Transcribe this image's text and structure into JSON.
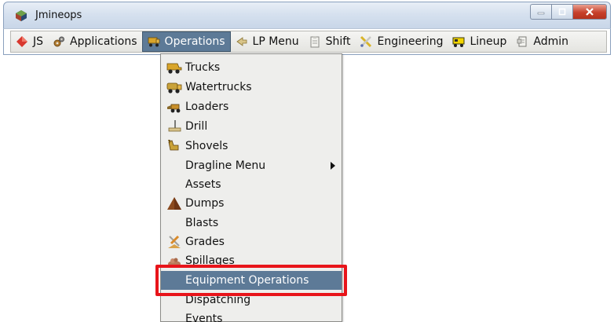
{
  "window": {
    "title": "Jmineops",
    "controls": {
      "minimize": "–",
      "maximize": "□",
      "close": "✕"
    }
  },
  "menubar": {
    "items": [
      {
        "label": "JS",
        "icon": "js-diamond-icon"
      },
      {
        "label": "Applications",
        "icon": "gears-icon"
      },
      {
        "label": "Operations",
        "icon": "truck-icon",
        "active": true
      },
      {
        "label": "LP Menu",
        "icon": "lp-arrow-icon"
      },
      {
        "label": "Shift",
        "icon": "clipboard-icon"
      },
      {
        "label": "Engineering",
        "icon": "tools-icon"
      },
      {
        "label": "Lineup",
        "icon": "lineup-truck-icon"
      },
      {
        "label": "Admin",
        "icon": "admin-icon"
      }
    ]
  },
  "dropdown": {
    "items": [
      {
        "label": "Trucks",
        "icon": "truck-icon"
      },
      {
        "label": "Watertrucks",
        "icon": "watertruck-icon"
      },
      {
        "label": "Loaders",
        "icon": "loader-icon"
      },
      {
        "label": "Drill",
        "icon": "drill-icon"
      },
      {
        "label": "Shovels",
        "icon": "shovel-icon"
      },
      {
        "label": "Dragline Menu",
        "icon": "",
        "submenu": true
      },
      {
        "label": "Assets",
        "icon": ""
      },
      {
        "label": "Dumps",
        "icon": "dump-pile-icon"
      },
      {
        "label": "Blasts",
        "icon": ""
      },
      {
        "label": "Grades",
        "icon": "grades-icon"
      },
      {
        "label": "Spillages",
        "icon": "spillage-icon"
      },
      {
        "label": "Equipment Operations",
        "icon": "",
        "highlighted": true
      },
      {
        "label": "Dispatching",
        "icon": ""
      },
      {
        "label": "Events",
        "icon": ""
      }
    ]
  },
  "colors": {
    "highlight_bg": "#5d7a97",
    "annotation_border": "#e8141a",
    "menu_bg": "#eeeeec"
  }
}
